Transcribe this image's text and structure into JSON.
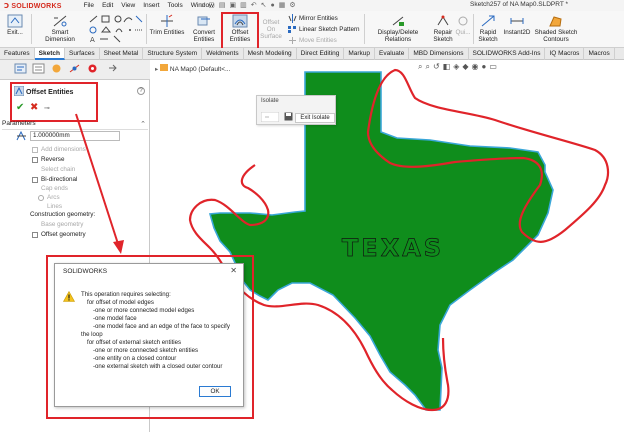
{
  "app": {
    "logo": "SOLIDWORKS",
    "menu": [
      "File",
      "Edit",
      "View",
      "Insert",
      "Tools",
      "Window"
    ],
    "doc_title": "Sketch257 of NA Map0.SLDPRT *"
  },
  "ribbon": {
    "exit_sketch": "Exit...",
    "smart_dimension": "Smart Dimension",
    "trim_entities": "Trim Entities",
    "convert_entities": "Convert Entities",
    "offset_entities": "Offset Entities",
    "offset_on_surface": "Offset On Surface",
    "mirror_entities": "Mirror Entities",
    "linear_pattern": "Linear Sketch Pattern",
    "move_entities": "Move Entities",
    "display_delete": "Display/Delete Relations",
    "repair_sketch": "Repair Sketch",
    "quick_snaps": "Qui...",
    "rapid_sketch": "Rapid Sketch",
    "instant2d": "Instant2D",
    "shaded_contours": "Shaded Sketch Contours"
  },
  "tabs": [
    "Features",
    "Sketch",
    "Surfaces",
    "Sheet Metal",
    "Structure System",
    "Weldments",
    "Mesh Modeling",
    "Direct Editing",
    "Markup",
    "Evaluate",
    "MBD Dimensions",
    "SOLIDWORKS Add-Ins",
    "IQ Macros",
    "Macros"
  ],
  "active_tab": "Sketch",
  "property_manager": {
    "title": "Offset Entities",
    "help": "?",
    "section": "Parameters",
    "distance": "1.000000mm",
    "options": {
      "add_dimensions": "Add dimensions",
      "reverse": "Reverse",
      "select_chain": "Select chain",
      "bidirectional": "Bi-directional",
      "cap_ends": "Cap ends",
      "arcs": "Arcs",
      "lines": "Lines"
    },
    "construction_label": "Construction geometry:",
    "base_geometry": "Base geometry",
    "offset_geometry": "Offset geometry"
  },
  "graphics": {
    "tree_label": "NA Map0 (Default<...",
    "map_label": "TEXAS",
    "fill_color": "#0f8d1c",
    "outline_color": "#3aa7d8",
    "markup_color": "#e0242a"
  },
  "isolate": {
    "title": "Isolate",
    "exit": "Exit Isolate"
  },
  "dialog": {
    "title": "SOLIDWORKS",
    "lines": [
      "This operation requires selecting:",
      "for offset of model edges",
      "-one or more connected model edges",
      "-one model face",
      "-one model face and an edge of the face to specify",
      "the loop",
      "for offset of external sketch entities",
      "-one or more connected sketch entities",
      "-one entity on a closed contour",
      "-one external sketch with a closed outer contour"
    ],
    "ok": "OK"
  }
}
